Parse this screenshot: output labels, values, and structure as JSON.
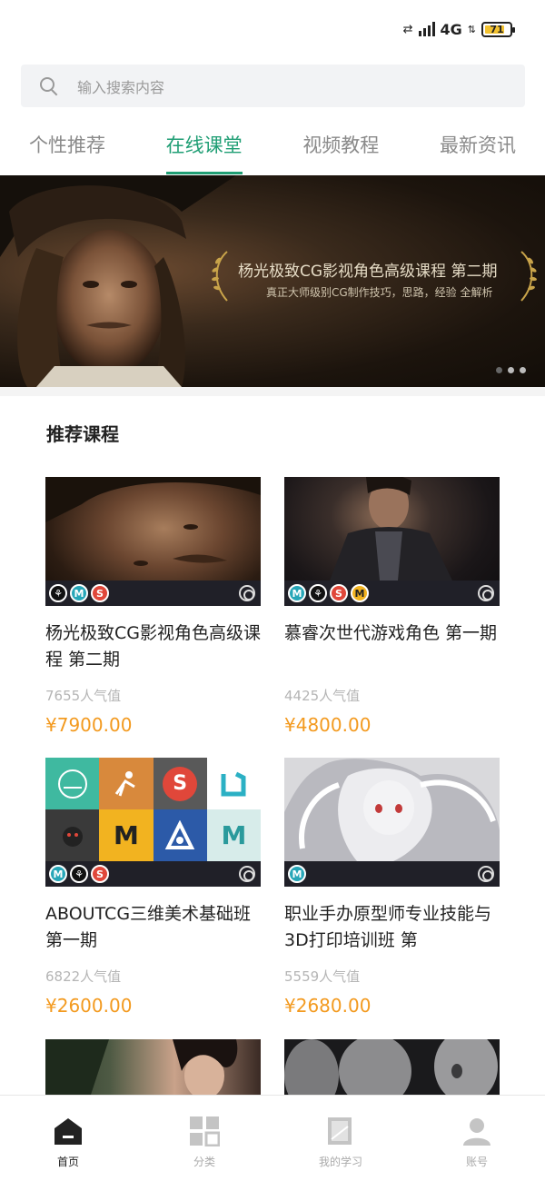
{
  "status_bar": {
    "network": "4G",
    "battery": "71"
  },
  "search": {
    "placeholder": "输入搜索内容"
  },
  "tabs": [
    {
      "label": "个性推荐",
      "active": false
    },
    {
      "label": "在线课堂",
      "active": true
    },
    {
      "label": "视频教程",
      "active": false
    },
    {
      "label": "最新资讯",
      "active": false
    }
  ],
  "banner": {
    "title": "杨光极致CG影视角色高级课程 第二期",
    "subtitle": "真正大师级别CG制作技巧，思路，经验 全解析",
    "slide_count": 3,
    "active_slide": 1
  },
  "section": {
    "title": "推荐课程"
  },
  "courses": [
    {
      "title": "杨光极致CG影视角色高级课程 第二期",
      "popularity": "7655人气值",
      "price": "¥7900.00"
    },
    {
      "title": "慕睿次世代游戏角色 第一期",
      "popularity": "4425人气值",
      "price": "¥4800.00"
    },
    {
      "title": "ABOUTCG三维美术基础班 第一期",
      "popularity": "6822人气值",
      "price": "¥2600.00"
    },
    {
      "title": "职业手办原型师专业技能与3D打印培训班 第",
      "popularity": "5559人气值",
      "price": "¥2680.00"
    }
  ],
  "grid_tiles": [
    "",
    "",
    "S",
    "",
    "",
    "M",
    "",
    "M"
  ],
  "bottom_nav": [
    {
      "label": "首页",
      "active": true
    },
    {
      "label": "分类",
      "active": false
    },
    {
      "label": "我的学习",
      "active": false
    },
    {
      "label": "账号",
      "active": false
    }
  ],
  "colors": {
    "accent": "#1f9e74",
    "price": "#f39a1f"
  }
}
